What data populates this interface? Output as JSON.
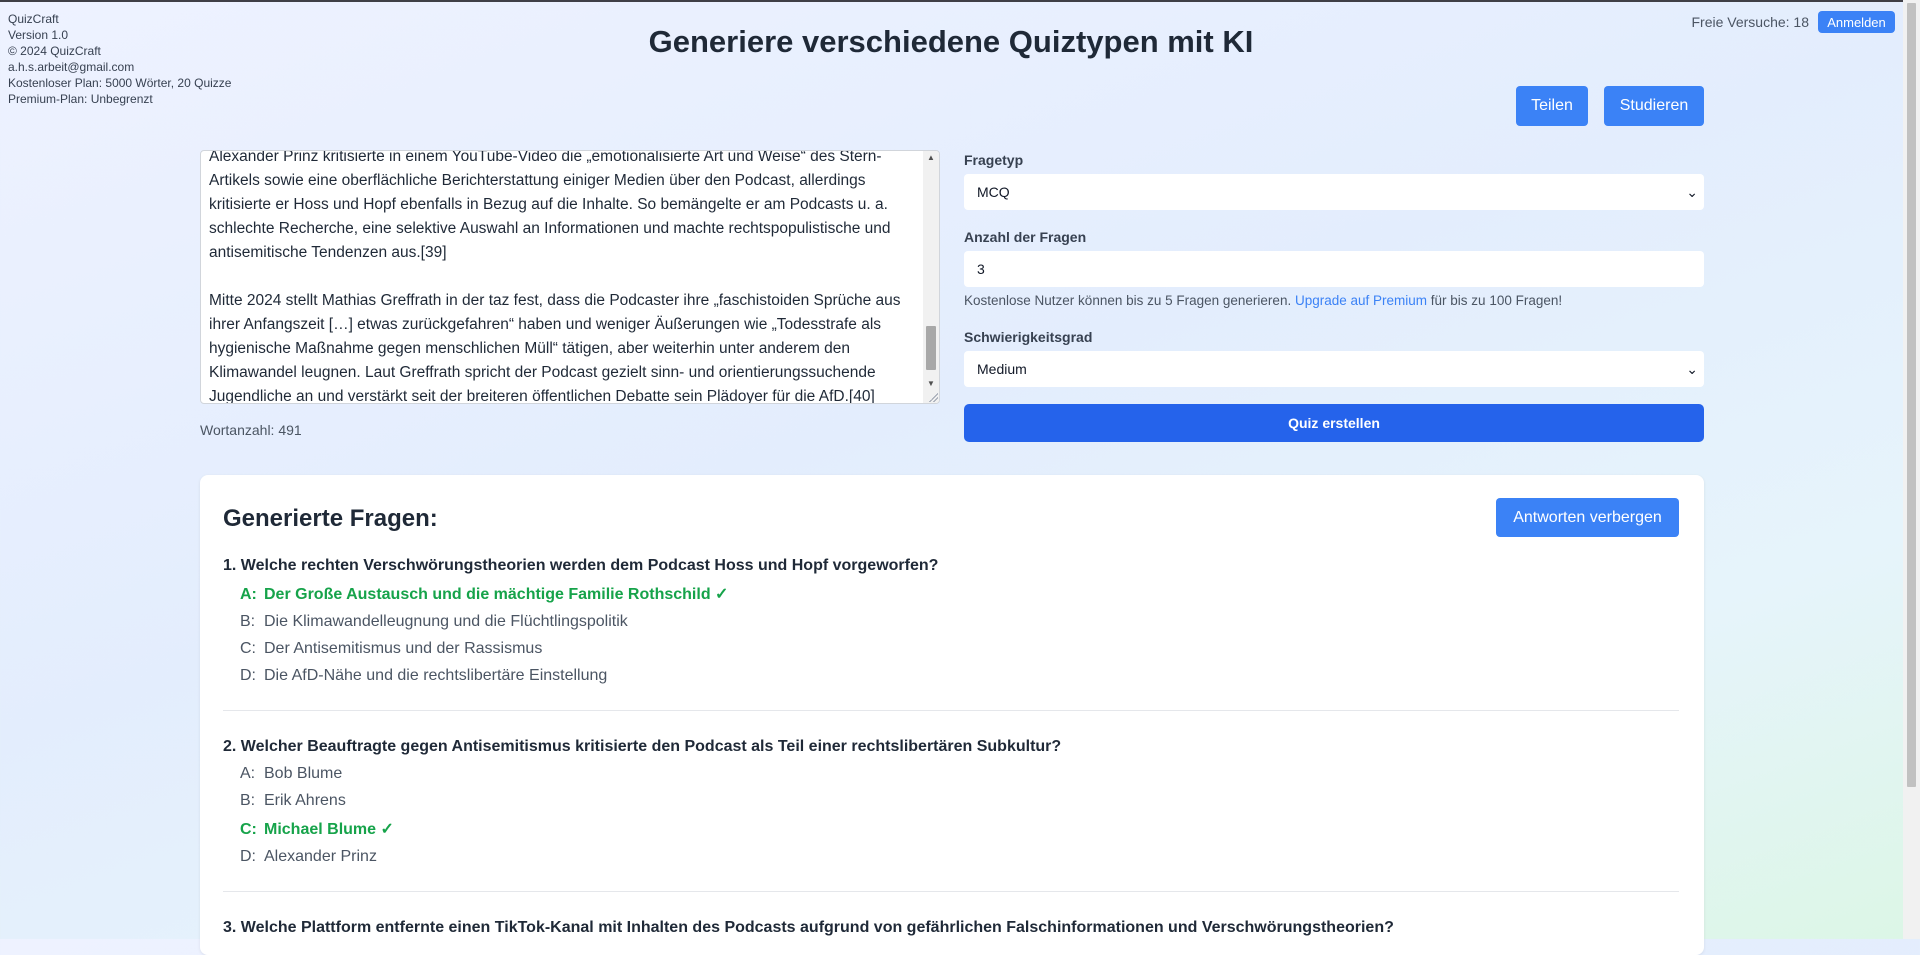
{
  "app_info": {
    "name": "QuizCraft",
    "version": "Version 1.0",
    "copyright": "© 2024 QuizCraft",
    "email": "a.h.s.arbeit@gmail.com",
    "free_plan": "Kostenloser Plan: 5000 Wörter, 20 Quizze",
    "premium_plan": "Premium-Plan: Unbegrenzt"
  },
  "header": {
    "title": "Generiere verschiedene Quiztypen mit KI",
    "free_trials": "Freie Versuche: 18",
    "login_label": "Anmelden",
    "share_label": "Teilen",
    "study_label": "Studieren"
  },
  "editor": {
    "paragraphs": [
      "Alexander Prinz kritisierte in einem YouTube-Video die „emotionalisierte Art und Weise“ des Stern-Artikels sowie eine oberflächliche Berichterstattung einiger Medien über den Podcast, allerdings kritisierte er Hoss und Hopf ebenfalls in Bezug auf die Inhalte. So bemängelte er am Podcasts u. a. schlechte Recherche, eine selektive Auswahl an Informationen und machte rechtspopulistische und antisemitische Tendenzen aus.[39]",
      "Mitte 2024 stellt Mathias Greffrath in der taz fest, dass die Podcaster ihre „faschistoiden Sprüche aus ihrer Anfangszeit […] etwas zurückgefahren“ haben und weniger Äußerungen wie „Todesstrafe als hygienische Maßnahme gegen menschlichen Müll“ tätigen, aber weiterhin unter anderem den Klimawandel leugnen. Laut Greffrath spricht der Podcast gezielt sinn- und orientierungssuchende Jugendliche an und verstärkt seit der breiteren öffentlichen Debatte sein Plädoyer für die AfD.[40]"
    ],
    "word_count": "Wortanzahl: 491"
  },
  "form": {
    "question_type_label": "Fragetyp",
    "question_type_value": "MCQ",
    "count_label": "Anzahl der Fragen",
    "count_value": "3",
    "hint_before": "Kostenlose Nutzer können bis zu 5 Fragen generieren.",
    "hint_link": "Upgrade auf Premium",
    "hint_after": "für bis zu 100 Fragen!",
    "difficulty_label": "Schwierigkeitsgrad",
    "difficulty_value": "Medium",
    "create_label": "Quiz erstellen"
  },
  "results": {
    "title": "Generierte Fragen:",
    "hide_answers_label": "Antworten verbergen",
    "questions": [
      {
        "text": "1. Welche rechten Verschwörungstheorien werden dem Podcast Hoss und Hopf vorgeworfen?",
        "options": [
          {
            "letter": "A:",
            "text": "Der Große Austausch und die mächtige Familie Rothschild ✓"
          },
          {
            "letter": "B:",
            "text": "Die Klimawandelleugnung und die Flüchtlingspolitik"
          },
          {
            "letter": "C:",
            "text": "Der Antisemitismus und der Rassismus"
          },
          {
            "letter": "D:",
            "text": "Die AfD-Nähe und die rechtslibertäre Einstellung"
          }
        ]
      },
      {
        "text": "2. Welcher Beauftragte gegen Antisemitismus kritisierte den Podcast als Teil einer rechtslibertären Subkultur?",
        "options": [
          {
            "letter": "A:",
            "text": "Bob Blume"
          },
          {
            "letter": "B:",
            "text": "Erik Ahrens"
          },
          {
            "letter": "C:",
            "text": "Michael Blume ✓"
          },
          {
            "letter": "D:",
            "text": "Alexander Prinz"
          }
        ]
      },
      {
        "text": "3. Welche Plattform entfernte einen TikTok-Kanal mit Inhalten des Podcasts aufgrund von gefährlichen Falschinformationen und Verschwörungstheorien?",
        "options": []
      }
    ]
  },
  "colors": {
    "primary": "#3b82f6",
    "primary_dark": "#2563eb",
    "correct": "#16a34a"
  }
}
